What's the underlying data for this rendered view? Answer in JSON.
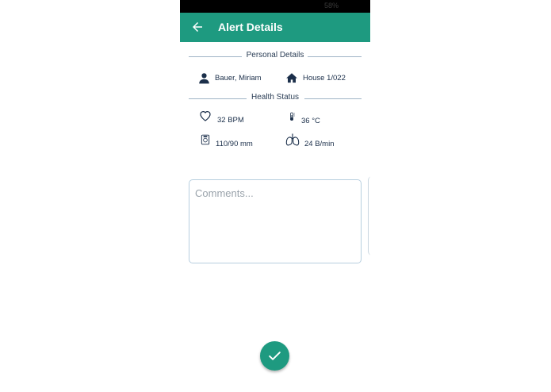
{
  "status_bar": {
    "battery": "58%"
  },
  "header": {
    "title": "Alert Details"
  },
  "sections": {
    "personal": "Personal Details",
    "health": "Health Status"
  },
  "personal": {
    "name": "Bauer, Miriam",
    "address": "House 1/022"
  },
  "health": {
    "heart_rate": "32 BPM",
    "temperature": "36 °C",
    "blood_pressure": "110/90 mm",
    "breathing": "24 B/min"
  },
  "comments": {
    "placeholder": "Comments..."
  },
  "icons": {
    "back": "arrow-left-icon",
    "person": "person-icon",
    "home": "home-icon",
    "heart": "heart-icon",
    "thermometer": "thermometer-icon",
    "blood_pressure": "blood-pressure-icon",
    "lungs": "lungs-icon",
    "confirm": "check-icon"
  },
  "colors": {
    "primary": "#1e9a80",
    "text": "#1b2f4a",
    "divider": "#9fb4c6"
  }
}
